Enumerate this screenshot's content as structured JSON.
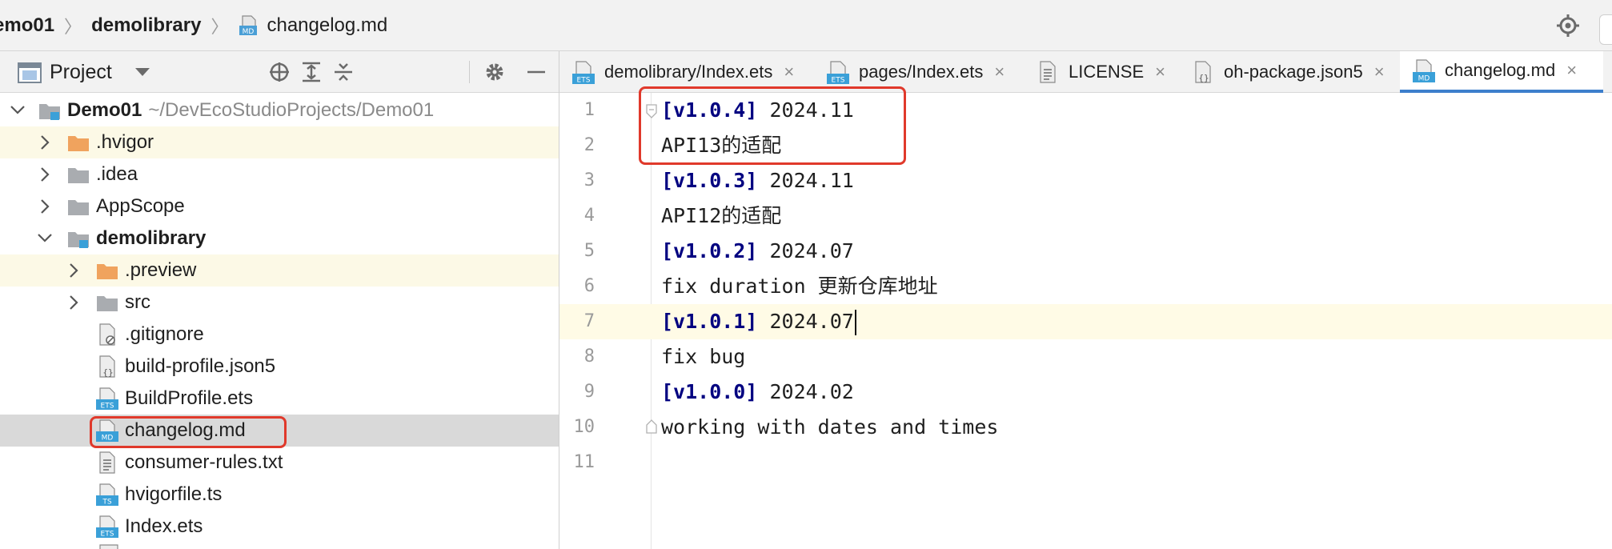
{
  "breadcrumb": {
    "project": "emo01",
    "module": "demolibrary",
    "file": "changelog.md",
    "separator": "〉"
  },
  "project_panel": {
    "title": "Project"
  },
  "tree": {
    "root": {
      "name": "Demo01",
      "path": "~/DevEcoStudioProjects/Demo01"
    },
    "items": [
      {
        "name": ".hvigor"
      },
      {
        "name": ".idea"
      },
      {
        "name": "AppScope"
      },
      {
        "name": "demolibrary"
      },
      {
        "name": ".preview"
      },
      {
        "name": "src"
      },
      {
        "name": ".gitignore"
      },
      {
        "name": "build-profile.json5"
      },
      {
        "name": "BuildProfile.ets"
      },
      {
        "name": "changelog.md"
      },
      {
        "name": "consumer-rules.txt"
      },
      {
        "name": "hvigorfile.ts"
      },
      {
        "name": "Index.ets"
      }
    ]
  },
  "tabs": [
    {
      "label": "demolibrary/Index.ets",
      "icon_text": "ETS"
    },
    {
      "label": "pages/Index.ets",
      "icon_text": "ETS"
    },
    {
      "label": "LICENSE"
    },
    {
      "label": "oh-package.json5",
      "icon_text": "{}"
    },
    {
      "label": "changelog.md",
      "icon_text": "MD"
    }
  ],
  "tab_close": "×",
  "file_badges": {
    "ets": "ETS",
    "md": "MD",
    "ts": "TS",
    "json": "{}"
  },
  "editor": {
    "lines": [
      {
        "num": "1",
        "version": "[v1.0.4]",
        "text": " 2024.11"
      },
      {
        "num": "2",
        "text": "API13的适配"
      },
      {
        "num": "3",
        "version": "[v1.0.3]",
        "text": " 2024.11"
      },
      {
        "num": "4",
        "text": "API12的适配"
      },
      {
        "num": "5",
        "version": "[v1.0.2]",
        "text": " 2024.07"
      },
      {
        "num": "6",
        "text": "fix duration 更新仓库地址"
      },
      {
        "num": "7",
        "version": "[v1.0.1]",
        "text": " 2024.07"
      },
      {
        "num": "8",
        "text": "fix bug"
      },
      {
        "num": "9",
        "version": "[v1.0.0]",
        "text": " 2024.02"
      },
      {
        "num": "10",
        "text": "working with dates and times"
      },
      {
        "num": "11",
        "text": ""
      }
    ]
  },
  "colors": {
    "accent": "#3d7fcc",
    "highlight_box": "#e0392b",
    "version_text": "#000080",
    "folder_orange": "#f0a35e",
    "folder_gray": "#a9acb0"
  }
}
